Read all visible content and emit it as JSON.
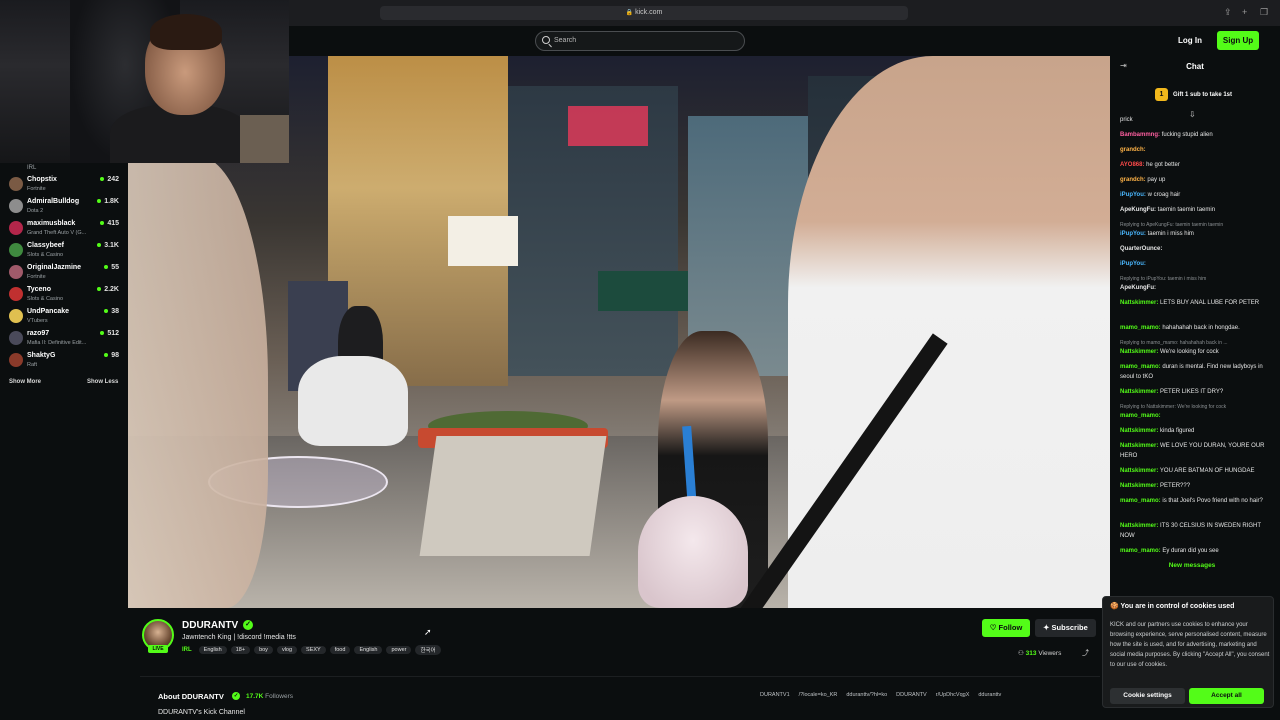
{
  "browser": {
    "url": "kick.com"
  },
  "header": {
    "search_placeholder": "Search",
    "login": "Log In",
    "signup": "Sign Up"
  },
  "sidebar": {
    "top_category": "IRL",
    "items": [
      {
        "name": "Chopstix",
        "category": "Fortnite",
        "viewers": "242",
        "color": "#7a5a44"
      },
      {
        "name": "AdmiralBulldog",
        "category": "Dota 2",
        "viewers": "1.8K",
        "color": "#8d8d8d"
      },
      {
        "name": "maximusblack",
        "category": "Grand Theft Auto V (G...",
        "viewers": "415",
        "color": "#b3264a"
      },
      {
        "name": "Classybeef",
        "category": "Slots & Casino",
        "viewers": "3.1K",
        "color": "#3f8a3f"
      },
      {
        "name": "OriginalJazmine",
        "category": "Fortnite",
        "viewers": "55",
        "color": "#a05a6a"
      },
      {
        "name": "Tyceno",
        "category": "Slots & Casino",
        "viewers": "2.2K",
        "color": "#c03030"
      },
      {
        "name": "UndPancake",
        "category": "VTubers",
        "viewers": "38",
        "color": "#e0c050"
      },
      {
        "name": "razo97",
        "category": "Mafia II: Definitive Edit...",
        "viewers": "512",
        "color": "#4a4a5a"
      },
      {
        "name": "ShaktyG",
        "category": "Raft",
        "viewers": "98",
        "color": "#8a3a2a"
      }
    ],
    "show_more": "Show More",
    "show_less": "Show Less"
  },
  "chat": {
    "title": "Chat",
    "gift_count": "1",
    "gift_text": "Gift 1 sub to take 1st",
    "new_messages": "New messages",
    "messages": [
      {
        "user": "",
        "text": "prick",
        "color": "#e6e6e6"
      },
      {
        "user": "Bambammng:",
        "text": "fucking stupid alien",
        "color": "#ff5fa0"
      },
      {
        "user": "grandch:",
        "text": "",
        "color": "#ffb347"
      },
      {
        "user": "AYO868:",
        "text": "he got better",
        "color": "#ff4a4a"
      },
      {
        "user": "grandch:",
        "text": "pay up",
        "color": "#ffb347"
      },
      {
        "user": "iPupYou:",
        "text": "w croag hair",
        "color": "#4ab8ff"
      },
      {
        "user": "ApeKungFu:",
        "text": "taemin taemin taemin",
        "color": "#e6e6e6"
      },
      {
        "reply": "Replying to ApeKungFu: taemin taemin taemin"
      },
      {
        "user": "iPupYou:",
        "text": "taemin  i miss him",
        "color": "#4ab8ff"
      },
      {
        "user": "QuarterOunce:",
        "text": "",
        "color": "#e6e6e6"
      },
      {
        "user": "iPupYou:",
        "text": "",
        "color": "#4ab8ff"
      },
      {
        "reply": "Replying to iPupYou: taemin  i miss him"
      },
      {
        "user": "ApeKungFu:",
        "text": "",
        "color": "#e6e6e6"
      },
      {
        "user": "Nattskimmer:",
        "text": "LETS BUY ANAL LUBE FOR PETER",
        "color": "#53fc18"
      },
      {
        "user": "mamo_mamo:",
        "text": "hahahahah back in hongdae.",
        "color": "#53fc18"
      },
      {
        "reply": "Replying to mamo_mamo: hahahahah back in ..."
      },
      {
        "user": "Nattskimmer:",
        "text": "We're looking for cock",
        "color": "#53fc18"
      },
      {
        "user": "mamo_mamo:",
        "text": "duran is mental. Find new ladyboys in seoul to tKO",
        "color": "#53fc18"
      },
      {
        "user": "Nattskimmer:",
        "text": "PETER LIKES IT DRY?",
        "color": "#53fc18"
      },
      {
        "reply": "Replying to Nattskimmer: We're looking for cock"
      },
      {
        "user": "mamo_mamo:",
        "text": "",
        "color": "#53fc18"
      },
      {
        "user": "Nattskimmer:",
        "text": "kinda figured",
        "color": "#53fc18"
      },
      {
        "user": "Nattskimmer:",
        "text": "WE LOVE YOU DURAN, YOURE OUR HERO",
        "color": "#53fc18"
      },
      {
        "user": "Nattskimmer:",
        "text": "YOU ARE BATMAN OF HUNGDAE",
        "color": "#53fc18"
      },
      {
        "user": "Nattskimmer:",
        "text": "PETER???",
        "color": "#53fc18"
      },
      {
        "user": "mamo_mamo:",
        "text": "is that Joel's Povo friend with no hair?",
        "color": "#53fc18"
      },
      {
        "user": "Nattskimmer:",
        "text": "ITS 30 CELSIUS IN SWEDEN RIGHT NOW",
        "color": "#53fc18"
      },
      {
        "user": "mamo_mamo:",
        "text": "Ey duran did you see",
        "color": "#53fc18"
      }
    ]
  },
  "cookie": {
    "title": "You are in control of cookies used",
    "body": "KICK and our partners use cookies to enhance your browsing experience, serve personalised content, measure how the site is used, and for advertising, marketing and social media purposes. By clicking \"Accept All\", you consent to our use of cookies.",
    "settings": "Cookie settings",
    "accept": "Accept all"
  },
  "stream": {
    "streamer": "DDURANTV",
    "live": "LIVE",
    "title": "Jawntench King | !discord !media !tts",
    "category": "IRL",
    "tags": [
      "English",
      "18+",
      "boy",
      "vlog",
      "SEXY",
      "food",
      "English",
      "power",
      "한국어"
    ],
    "follow": "Follow",
    "subscribe": "Subscribe",
    "viewers_count": "313",
    "viewers_label": "Viewers"
  },
  "about": {
    "title": "About DDURANTV",
    "followers_count": "17.7K",
    "followers_label": "Followers",
    "description": "DDURANTV's Kick Channel",
    "socials": [
      "DURANTV1",
      "/?locale=ko_KR",
      "dduranttv/?hl=ko",
      "DDURANTV",
      "r/UpDhcVqgX",
      "dduranttv"
    ]
  },
  "colors": {
    "accent": "#53fc18",
    "background": "#0b0e0f"
  }
}
